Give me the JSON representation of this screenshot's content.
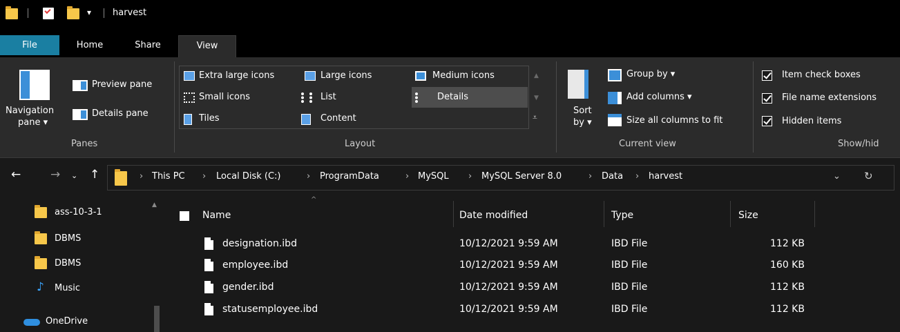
{
  "window": {
    "title": "harvest"
  },
  "tabs": {
    "file": "File",
    "home": "Home",
    "share": "Share",
    "view": "View"
  },
  "ribbon": {
    "panes": {
      "navigation_pane_line1": "Navigation",
      "navigation_pane_line2": "pane ▾",
      "preview_pane": "Preview pane",
      "details_pane": "Details pane",
      "group_label": "Panes"
    },
    "layout": {
      "extra_large_icons": "Extra large icons",
      "large_icons": "Large icons",
      "medium_icons": "Medium icons",
      "small_icons": "Small icons",
      "list": "List",
      "details": "Details",
      "tiles": "Tiles",
      "content": "Content",
      "group_label": "Layout"
    },
    "current_view": {
      "sort_by_line1": "Sort",
      "sort_by_line2": "by ▾",
      "group_by": "Group by ▾",
      "add_columns": "Add columns ▾",
      "size_all_columns": "Size all columns to fit",
      "group_label": "Current view"
    },
    "show_hide": {
      "item_check_boxes": "Item check boxes",
      "file_name_extensions": "File name extensions",
      "hidden_items": "Hidden items",
      "group_label": "Show/hid"
    }
  },
  "address": {
    "crumbs": [
      "This PC",
      "Local Disk (C:)",
      "ProgramData",
      "MySQL",
      "MySQL Server 8.0",
      "Data",
      "harvest"
    ]
  },
  "nav_pane": {
    "items": [
      "ass-10-3-1",
      "DBMS",
      "DBMS",
      "Music",
      "OneDrive"
    ]
  },
  "file_list": {
    "columns": [
      "Name",
      "Date modified",
      "Type",
      "Size"
    ],
    "rows": [
      {
        "name": "designation.ibd",
        "date": "10/12/2021 9:59 AM",
        "type": "IBD File",
        "size": "112 KB"
      },
      {
        "name": "employee.ibd",
        "date": "10/12/2021 9:59 AM",
        "type": "IBD File",
        "size": "160 KB"
      },
      {
        "name": "gender.ibd",
        "date": "10/12/2021 9:59 AM",
        "type": "IBD File",
        "size": "112 KB"
      },
      {
        "name": "statusemployee.ibd",
        "date": "10/12/2021 9:59 AM",
        "type": "IBD File",
        "size": "112 KB"
      }
    ]
  },
  "colors": {
    "file_tab": "#1a7fa2",
    "folder": "#f7c74a",
    "background": "#191919",
    "ribbon": "#2b2b2b"
  }
}
